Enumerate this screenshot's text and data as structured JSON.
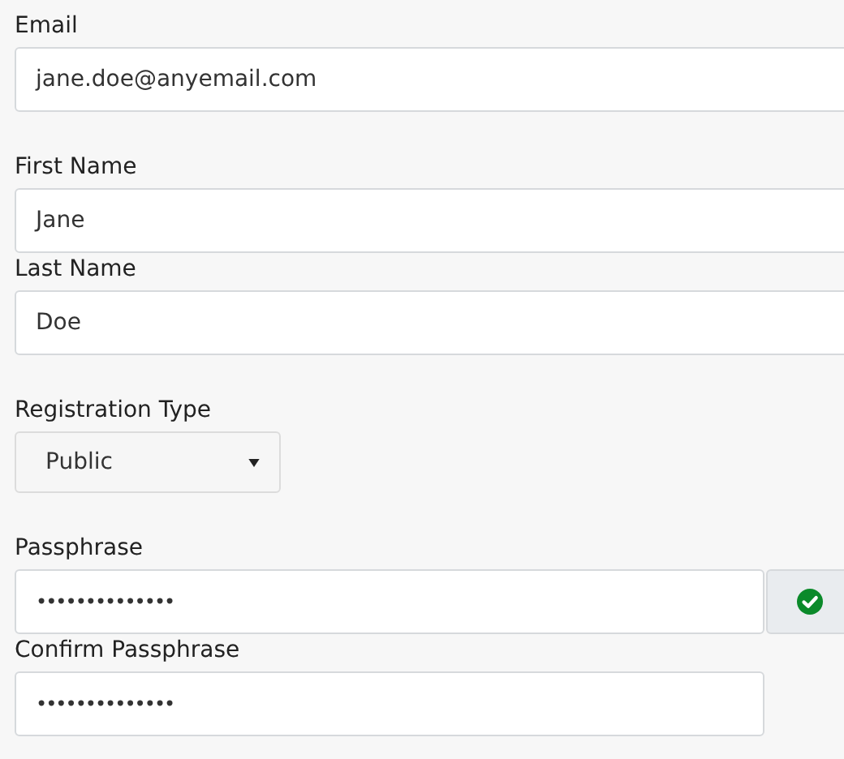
{
  "sections": [
    {
      "fields": [
        {
          "kind": "text",
          "label": "Email",
          "value": "jane.doe@anyemail.com"
        }
      ]
    },
    {
      "fields": [
        {
          "kind": "text",
          "label": "First Name",
          "value": "Jane"
        },
        {
          "kind": "text",
          "label": "Last Name",
          "value": "Doe"
        }
      ]
    },
    {
      "fields": [
        {
          "kind": "select",
          "label": "Registration Type",
          "value": "Public"
        }
      ]
    },
    {
      "fields": [
        {
          "kind": "password",
          "label": "Passphrase",
          "value": "••••••••••••••",
          "valid": true
        },
        {
          "kind": "password",
          "label": "Confirm Passphrase",
          "value": "••••••••••••••",
          "valid": false
        }
      ]
    }
  ]
}
